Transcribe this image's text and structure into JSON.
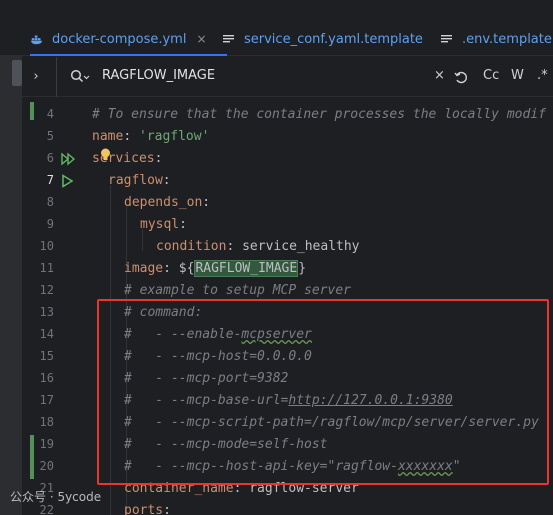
{
  "tabs": [
    {
      "label": "docker-compose.yml",
      "icon": "docker-icon",
      "active": true,
      "close": "×"
    },
    {
      "label": "service_conf.yaml.template",
      "icon": "text-file-icon",
      "active": false
    },
    {
      "label": ".env.template",
      "icon": "text-file-icon",
      "active": false
    }
  ],
  "search": {
    "chevron": "›",
    "query": "RAGFLOW_IMAGE",
    "clear": "×",
    "match_case": "Cc",
    "words": "W",
    "regex": ".*"
  },
  "gutter": [
    "4",
    "5",
    "6",
    "7",
    "8",
    "9",
    "10",
    "11",
    "12",
    "13",
    "14",
    "15",
    "16",
    "17",
    "18",
    "19",
    "20",
    "21",
    "22"
  ],
  "code": {
    "l4_comment": "# To ensure that the container processes the locally modif",
    "l5_key": "name",
    "l5_val": "'ragflow'",
    "l6_key": "services",
    "l7_key": "ragflow",
    "l8_key": "depends_on",
    "l9_key": "mysql",
    "l10_key": "condition",
    "l10_val": "service_healthy",
    "l11_key": "image",
    "l11_pre": "${",
    "l11_match": "RAGFLOW_IMAGE",
    "l11_post": "}",
    "l12": "# example to setup MCP server",
    "l13": "# command:",
    "l14_pre": "#   - --enable-",
    "l14_spell": "mcpserver",
    "l15": "#   - --mcp-host=0.0.0.0",
    "l16": "#   - --mcp-port=9382",
    "l17_pre": "#   - --mcp-base-url=",
    "l17_link": "http://127.0.0.1:9380",
    "l18": "#   - --mcp-script-path=/ragflow/mcp/server/server.py",
    "l19": "#   - --mcp-mode=self-host",
    "l20_pre": "#   - --mcp--host-api-key=\"ragflow-",
    "l20_spell": "xxxxxxx",
    "l20_post": "\"",
    "l21_key": "container_name",
    "l21_val": "ragflow-server",
    "l22_key": "ports"
  },
  "watermark": "公众号 · 5ycode",
  "colors": {
    "accent": "#3574f0",
    "highlight_box": "#e8352e",
    "change_bar": "#549159"
  }
}
